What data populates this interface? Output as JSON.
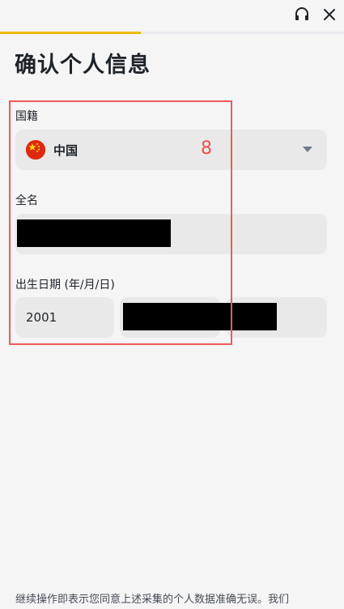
{
  "header": {
    "support_icon": "headset-icon",
    "close_icon": "close-icon",
    "progress_fraction": 0.41,
    "accent_color": "#f0b90b"
  },
  "page_title": "确认个人信息",
  "nationality": {
    "label": "国籍",
    "value": "中国",
    "flag_icon": "china-flag-icon"
  },
  "annotation_number": "8",
  "full_name": {
    "label": "全名"
  },
  "birth_date": {
    "label": "出生日期 (年/月/日)",
    "year": "2001"
  },
  "footer_text": "继续操作即表示您同意上述采集的个人数据准确无误。我们"
}
